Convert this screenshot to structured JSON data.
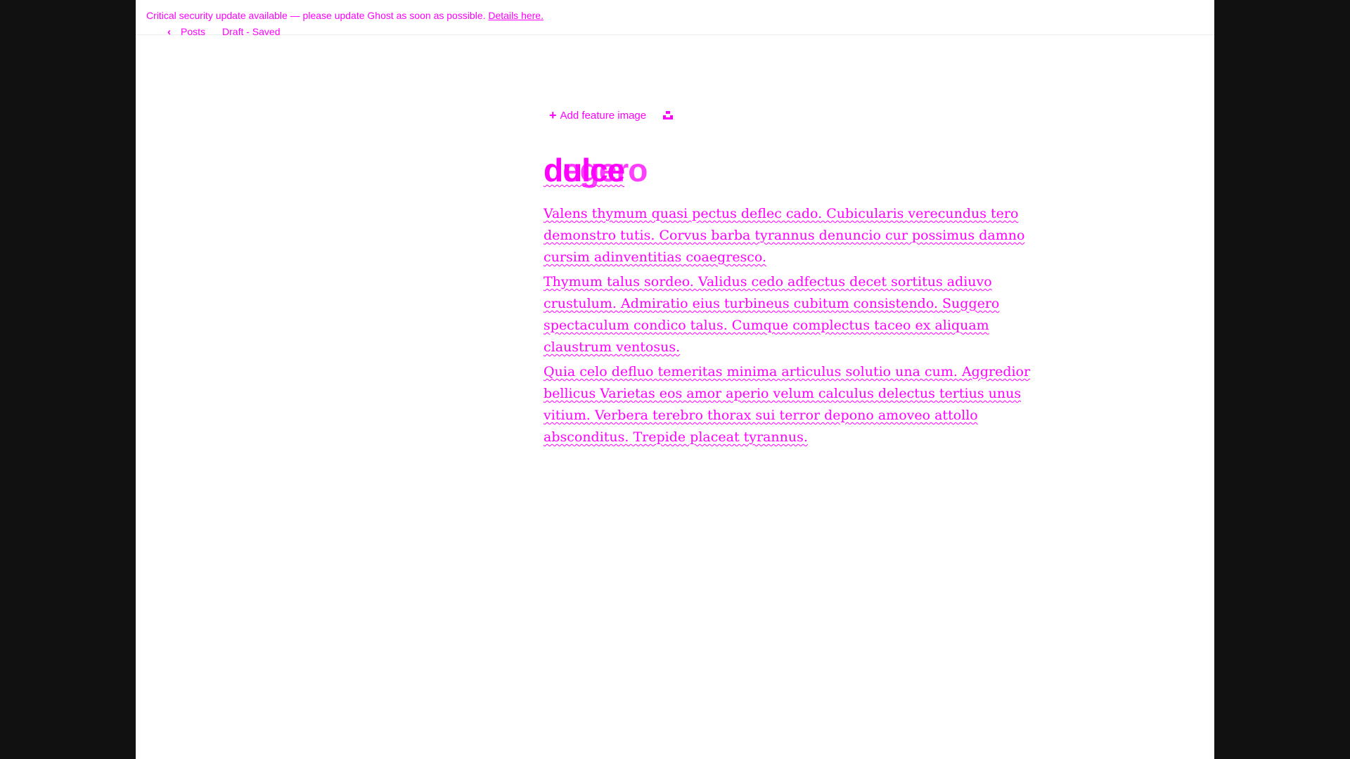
{
  "banner": {
    "message": "Critical security update available — please update Ghost as soon as possible.",
    "link_label": "Details here."
  },
  "topbar": {
    "back_label": "Posts",
    "status": "Draft - Saved"
  },
  "editor": {
    "add_feature_image": "Add feature image",
    "title": "dulce",
    "title_ghost": "degero",
    "paragraphs": [
      "Valens thymum quasi pectus deflec cado. Cubicularis verecundus tero demonstro tutis. Corvus barba tyrannus denuncio cur possimus damno cursim adinventitias coaegresco.",
      "Thymum talus sordeo. Validus cedo adfectus decet sortitus adiuvo crustulum. Admiratio eius turbineus cubitum consistendo. Suggero spectaculum condico talus. Cumque complectus taceo ex aliquam claustrum ventosus.",
      "Quia celo defluo temeritas minima articulus solutio una cum. Aggredior bellicus Varietas eos amor aperio velum calculus delectus tertius unus vitium. Verbera terebro thorax sui terror depono amoveo attollo absconditus. Trepide placeat tyrannus."
    ]
  },
  "colors": {
    "accent": "#ff00ff",
    "background": "#ffffff",
    "frame": "#111111"
  }
}
